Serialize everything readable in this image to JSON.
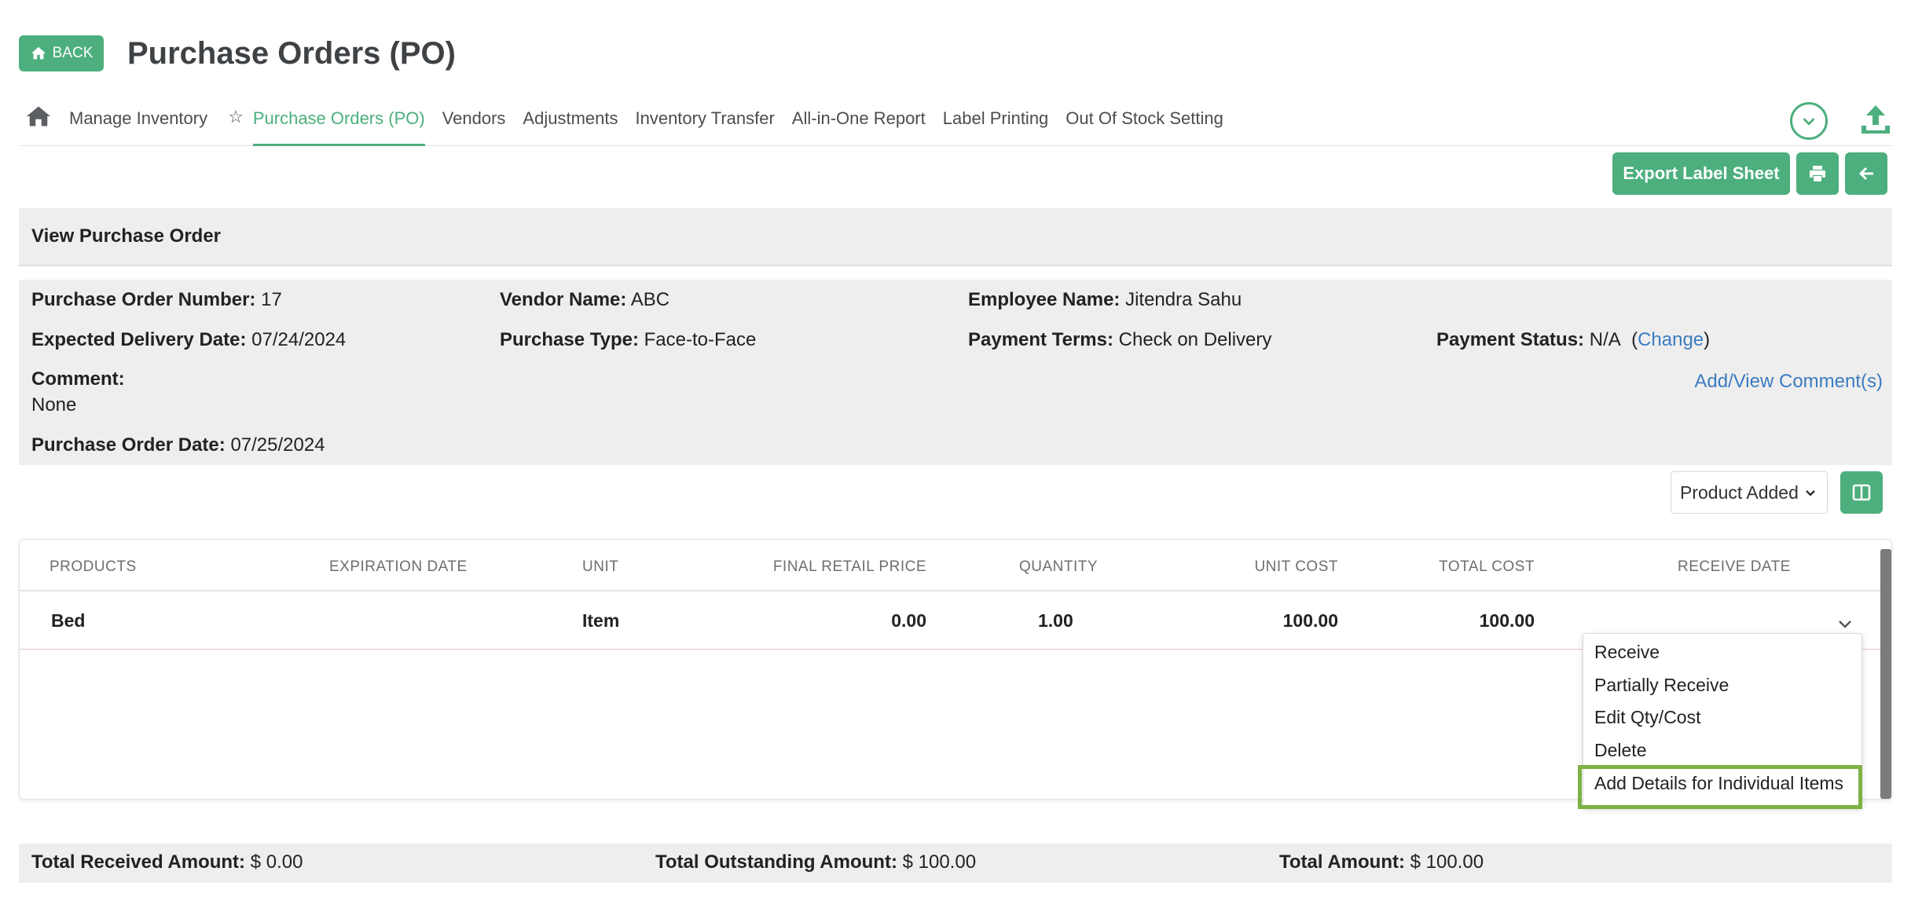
{
  "header": {
    "back_label": "BACK",
    "title": "Purchase Orders (PO)"
  },
  "nav": {
    "items": [
      {
        "label": "Manage Inventory"
      },
      {
        "label": "Purchase Orders (PO)",
        "active": true
      },
      {
        "label": "Vendors"
      },
      {
        "label": "Adjustments"
      },
      {
        "label": "Inventory Transfer"
      },
      {
        "label": "All-in-One Report"
      },
      {
        "label": "Label Printing"
      },
      {
        "label": "Out Of Stock Setting"
      }
    ]
  },
  "toolbar": {
    "export_label": "Export Label Sheet"
  },
  "view": {
    "title": "View Purchase Order"
  },
  "po": {
    "number_label": "Purchase Order Number:",
    "number": "17",
    "vendor_label": "Vendor Name:",
    "vendor": "ABC",
    "employee_label": "Employee Name:",
    "employee": "Jitendra Sahu",
    "expected_label": "Expected Delivery Date:",
    "expected": "07/24/2024",
    "type_label": "Purchase Type:",
    "type": "Face-to-Face",
    "terms_label": "Payment Terms:",
    "terms": "Check on Delivery",
    "status_label": "Payment Status:",
    "status": "N/A",
    "status_change": "Change",
    "comment_label": "Comment:",
    "comment": "None",
    "comment_link": "Add/View Comment(s)",
    "date_label": "Purchase Order Date:",
    "date": "07/25/2024"
  },
  "filter": {
    "selected": "Product Added"
  },
  "table": {
    "columns": [
      "PRODUCTS",
      "EXPIRATION DATE",
      "UNIT",
      "FINAL RETAIL PRICE",
      "QUANTITY",
      "UNIT COST",
      "TOTAL COST",
      "RECEIVE DATE"
    ],
    "rows": [
      {
        "product": "Bed",
        "expiration": "",
        "unit": "Item",
        "final_retail_price": "0.00",
        "quantity": "1.00",
        "unit_cost": "100.00",
        "total_cost": "100.00",
        "receive_date": ""
      }
    ]
  },
  "row_menu": {
    "items": [
      "Receive",
      "Partially Receive",
      "Edit Qty/Cost",
      "Delete",
      "Add Details for Individual Items"
    ],
    "highlighted": "Add Details for Individual Items"
  },
  "totals": {
    "received_label": "Total Received Amount:",
    "received": "$ 0.00",
    "outstanding_label": "Total Outstanding Amount:",
    "outstanding": "$ 100.00",
    "total_label": "Total Amount:",
    "total": "$ 100.00"
  },
  "colors": {
    "accent": "#4caf7d",
    "link": "#3b7bc0",
    "highlight_border": "#7cb342"
  }
}
